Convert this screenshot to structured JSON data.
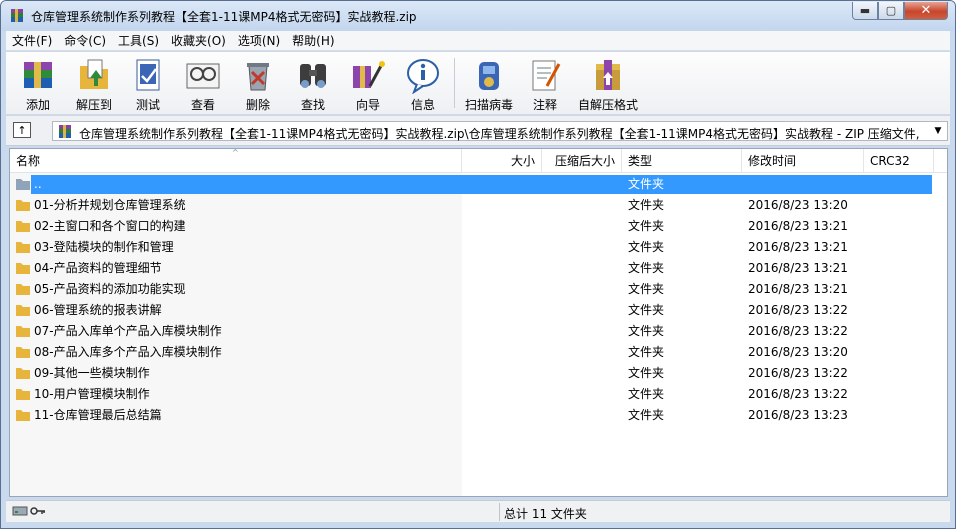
{
  "window": {
    "title": "仓库管理系统制作系列教程【全套1-11课MP4格式无密码】实战教程.zip",
    "controls": {
      "minimize": "▬",
      "maximize": "▢",
      "close": "✕"
    }
  },
  "menu": [
    "文件(F)",
    "命令(C)",
    "工具(S)",
    "收藏夹(O)",
    "选项(N)",
    "帮助(H)"
  ],
  "toolbar": [
    {
      "label": "添加",
      "icon": "add-archive-icon"
    },
    {
      "label": "解压到",
      "icon": "extract-to-icon"
    },
    {
      "label": "测试",
      "icon": "test-icon"
    },
    {
      "label": "查看",
      "icon": "view-icon"
    },
    {
      "label": "删除",
      "icon": "delete-icon"
    },
    {
      "label": "查找",
      "icon": "find-icon"
    },
    {
      "label": "向导",
      "icon": "wizard-icon"
    },
    {
      "label": "信息",
      "icon": "info-icon"
    },
    {
      "label": "扫描病毒",
      "icon": "virus-scan-icon"
    },
    {
      "label": "注释",
      "icon": "comment-icon"
    },
    {
      "label": "自解压格式",
      "icon": "sfx-icon"
    }
  ],
  "address": {
    "up_icon": "↑",
    "path": "仓库管理系统制作系列教程【全套1-11课MP4格式无密码】实战教程.zip\\仓库管理系统制作系列教程【全套1-11课MP4格式无密码】实战教程 - ZIP 压缩文件, 解",
    "dropdown_icon": "▼"
  },
  "columns": {
    "name": "名称",
    "size": "大小",
    "packed": "压缩后大小",
    "type": "类型",
    "modified": "修改时间",
    "crc": "CRC32",
    "sort_arrow": "^"
  },
  "files": [
    {
      "name": "..",
      "type": "文件夹",
      "modified": ""
    },
    {
      "name": "01-分析并规划仓库管理系统",
      "type": "文件夹",
      "modified": "2016/8/23 13:20"
    },
    {
      "name": "02-主窗口和各个窗口的构建",
      "type": "文件夹",
      "modified": "2016/8/23 13:21"
    },
    {
      "name": "03-登陆模块的制作和管理",
      "type": "文件夹",
      "modified": "2016/8/23 13:21"
    },
    {
      "name": "04-产品资料的管理细节",
      "type": "文件夹",
      "modified": "2016/8/23 13:21"
    },
    {
      "name": "05-产品资料的添加功能实现",
      "type": "文件夹",
      "modified": "2016/8/23 13:21"
    },
    {
      "name": "06-管理系统的报表讲解",
      "type": "文件夹",
      "modified": "2016/8/23 13:22"
    },
    {
      "name": "07-产品入库单个产品入库模块制作",
      "type": "文件夹",
      "modified": "2016/8/23 13:22"
    },
    {
      "name": "08-产品入库多个产品入库模块制作",
      "type": "文件夹",
      "modified": "2016/8/23 13:20"
    },
    {
      "name": "09-其他一些模块制作",
      "type": "文件夹",
      "modified": "2016/8/23 13:22"
    },
    {
      "name": "10-用户管理模块制作",
      "type": "文件夹",
      "modified": "2016/8/23 13:22"
    },
    {
      "name": "11-仓库管理最后总结篇",
      "type": "文件夹",
      "modified": "2016/8/23 13:23"
    }
  ],
  "status": {
    "summary": "总计 11 文件夹"
  },
  "colors": {
    "selection": "#3399ff",
    "folder": "#e8b53c",
    "titlebar": "#c9d9ee"
  }
}
